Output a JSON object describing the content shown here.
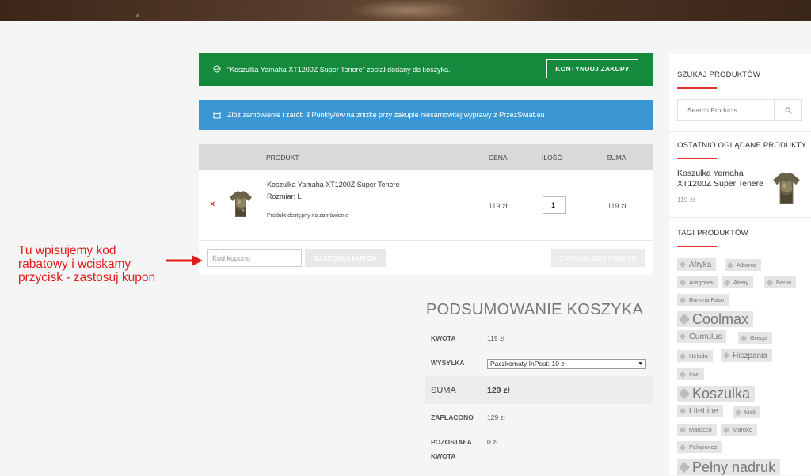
{
  "notices": {
    "added_message": "“Koszulka Yamaha XT1200Z Super Tenere” został dodany do koszyka.",
    "continue_label": "KONTYNUUJ ZAKUPY",
    "points_message": "Złóż zamówienie i zarób 3 Punkty/ów na zniżkę przy zakupie niesamowitej wyprawy z PrzezSwiat.eu"
  },
  "cart": {
    "headers": {
      "product": "PRODUKT",
      "price": "CENA",
      "qty": "ILOŚĆ",
      "total": "SUMA"
    },
    "item": {
      "remove": "×",
      "name": "Koszulka Yamaha XT1200Z Super Tenere",
      "size_label": "Rozmiar:",
      "size_value": "L",
      "note": "Produkt dostępny na zamówienie",
      "price": "119 zł",
      "qty": "1",
      "total": "119 zł"
    },
    "coupon_placeholder": "Kod kuponu",
    "apply_label": "ZASTOSUJ KUPON",
    "update_label": "ZAKTUALIZUJ KOSZYK"
  },
  "annotation": {
    "line1": "Tu wpisujemy kod",
    "line2": "rabatowy i wciskamy",
    "line3": "przycisk - zastosuj kupon",
    "color": "#e31b1b"
  },
  "summary": {
    "title": "PODSUMOWANIE KOSZYKA",
    "amount_label": "KWOTA",
    "amount": "119 zł",
    "shipping_label": "WYSYŁKA",
    "shipping_option": "Paczkomaty InPost: 10 zł",
    "total_label": "SUMA",
    "total": "129 zł",
    "paid_label": "ZAPŁACONO",
    "paid": "129 zł",
    "remaining_label_1": "POZOSTAŁA",
    "remaining_label_2": "KWOTA",
    "remaining": "0 zł"
  },
  "sidebar": {
    "search_title": "SZUKAJ PRODUKTÓW",
    "search_placeholder": "Search Products...",
    "recent_title": "OSTATNIO OGLĄDANE PRODUKTY",
    "recent_name": "Koszulka Yamaha XT1200Z Super Tenere",
    "recent_price": "119 zł",
    "tags_title": "TAGI PRODUKTÓW",
    "tags": [
      "Afryka",
      "Albania",
      "Aragonia",
      "Ateny",
      "Benin",
      "Burkina Faso",
      "Coolmax",
      "Cumulus",
      "Grecja",
      "Helada",
      "Hiszpania",
      "Iran",
      "Koszulka",
      "LiteLine",
      "Mali",
      "Marocco",
      "Maroko",
      "Peloponez",
      "Pełny nadruk"
    ]
  },
  "colors": {
    "success": "#158a3c",
    "info": "#3a97d3",
    "accent": "#d9302b"
  }
}
